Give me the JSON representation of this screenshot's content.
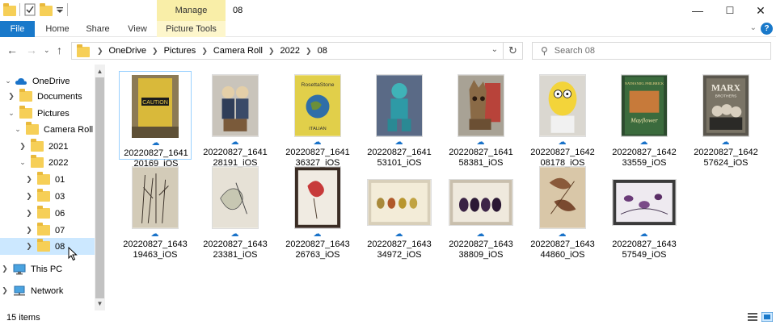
{
  "window": {
    "title": "08",
    "manage_label": "Manage"
  },
  "controls": {
    "minimize": "—",
    "maximize": "☐",
    "close": "✕"
  },
  "ribbon": {
    "tabs": [
      {
        "label": "File"
      },
      {
        "label": "Home"
      },
      {
        "label": "Share"
      },
      {
        "label": "View"
      },
      {
        "label": "Picture Tools"
      }
    ],
    "help": "?"
  },
  "address": {
    "crumbs": [
      "OneDrive",
      "Pictures",
      "Camera Roll",
      "2022",
      "08"
    ]
  },
  "search": {
    "placeholder": "Search 08"
  },
  "nav": {
    "items": [
      {
        "label": "OneDrive",
        "level": 0,
        "expanded": true,
        "icon": "cloud"
      },
      {
        "label": "Documents",
        "level": 1,
        "expanded": false,
        "icon": "folder"
      },
      {
        "label": "Pictures",
        "level": 1,
        "expanded": true,
        "icon": "folder"
      },
      {
        "label": "Camera Roll",
        "level": 2,
        "expanded": true,
        "icon": "folder"
      },
      {
        "label": "2021",
        "level": 3,
        "expanded": false,
        "icon": "folder"
      },
      {
        "label": "2022",
        "level": 3,
        "expanded": true,
        "icon": "folder"
      },
      {
        "label": "01",
        "level": 4,
        "expanded": false,
        "icon": "folder"
      },
      {
        "label": "03",
        "level": 4,
        "expanded": false,
        "icon": "folder"
      },
      {
        "label": "06",
        "level": 4,
        "expanded": false,
        "icon": "folder"
      },
      {
        "label": "07",
        "level": 4,
        "expanded": false,
        "icon": "folder"
      },
      {
        "label": "08",
        "level": 4,
        "expanded": false,
        "icon": "folder",
        "selected": true
      },
      {
        "label": "This PC",
        "level": 0,
        "expanded": false,
        "icon": "pc"
      },
      {
        "label": "Network",
        "level": 0,
        "expanded": false,
        "icon": "network"
      }
    ]
  },
  "files": [
    {
      "line1": "20220827_1641",
      "line2": "20169_iOS"
    },
    {
      "line1": "20220827_1641",
      "line2": "28191_iOS"
    },
    {
      "line1": "20220827_1641",
      "line2": "36327_iOS"
    },
    {
      "line1": "20220827_1641",
      "line2": "53101_iOS"
    },
    {
      "line1": "20220827_1641",
      "line2": "58381_iOS"
    },
    {
      "line1": "20220827_1642",
      "line2": "08178_iOS"
    },
    {
      "line1": "20220827_1642",
      "line2": "33559_iOS"
    },
    {
      "line1": "20220827_1642",
      "line2": "57624_iOS"
    },
    {
      "line1": "20220827_1643",
      "line2": "19463_iOS"
    },
    {
      "line1": "20220827_1643",
      "line2": "23381_iOS"
    },
    {
      "line1": "20220827_1643",
      "line2": "26763_iOS"
    },
    {
      "line1": "20220827_1643",
      "line2": "34972_iOS"
    },
    {
      "line1": "20220827_1643",
      "line2": "38809_iOS"
    },
    {
      "line1": "20220827_1643",
      "line2": "44860_iOS"
    },
    {
      "line1": "20220827_1643",
      "line2": "57549_iOS"
    }
  ],
  "thumb_text": {
    "caution": "CAUTION",
    "rosetta": "RosettaStone",
    "italian": "ITALIAN",
    "author": "NATHANIEL PHILBRICK",
    "book": "Mayflower",
    "marx": "MARX",
    "marx_sub": "BROTHERS"
  },
  "status": {
    "count": "15 items"
  },
  "colors": {
    "accent": "#1979ca",
    "selection": "#cce8ff",
    "folder": "#f6cf57",
    "manage": "#f9eea8"
  }
}
